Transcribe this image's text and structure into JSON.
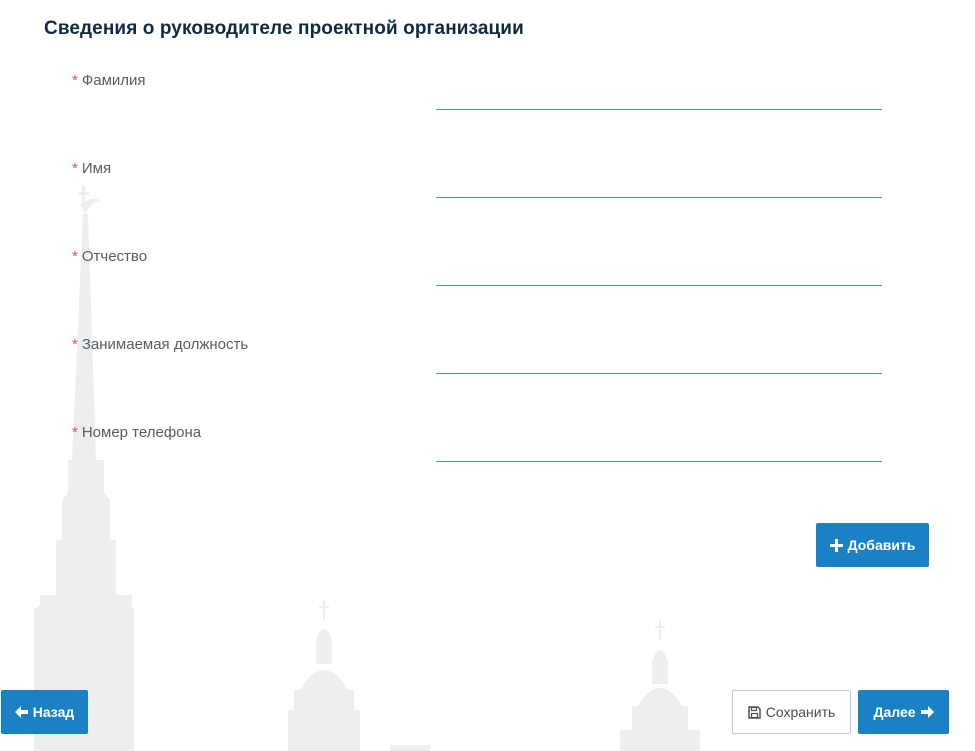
{
  "form": {
    "title": "Сведения о руководителе проектной организации",
    "required_mark": "*",
    "fields": [
      {
        "label": "Фамилия",
        "value": ""
      },
      {
        "label": "Имя",
        "value": ""
      },
      {
        "label": "Отчество",
        "value": ""
      },
      {
        "label": "Занимаемая должность",
        "value": ""
      },
      {
        "label": "Номер телефона",
        "value": ""
      }
    ]
  },
  "buttons": {
    "add_label": "Добавить",
    "back_label": "Назад",
    "save_label": "Сохранить",
    "next_label": "Далее"
  },
  "icons": {
    "add": "plus-icon",
    "back": "arrow-left-icon",
    "save": "floppy-disk-icon",
    "next": "arrow-right-icon"
  },
  "colors": {
    "primary": "#1a82c4",
    "title": "#0f2a44",
    "required": "#d9534f",
    "input_underline": "#4a90c2"
  }
}
